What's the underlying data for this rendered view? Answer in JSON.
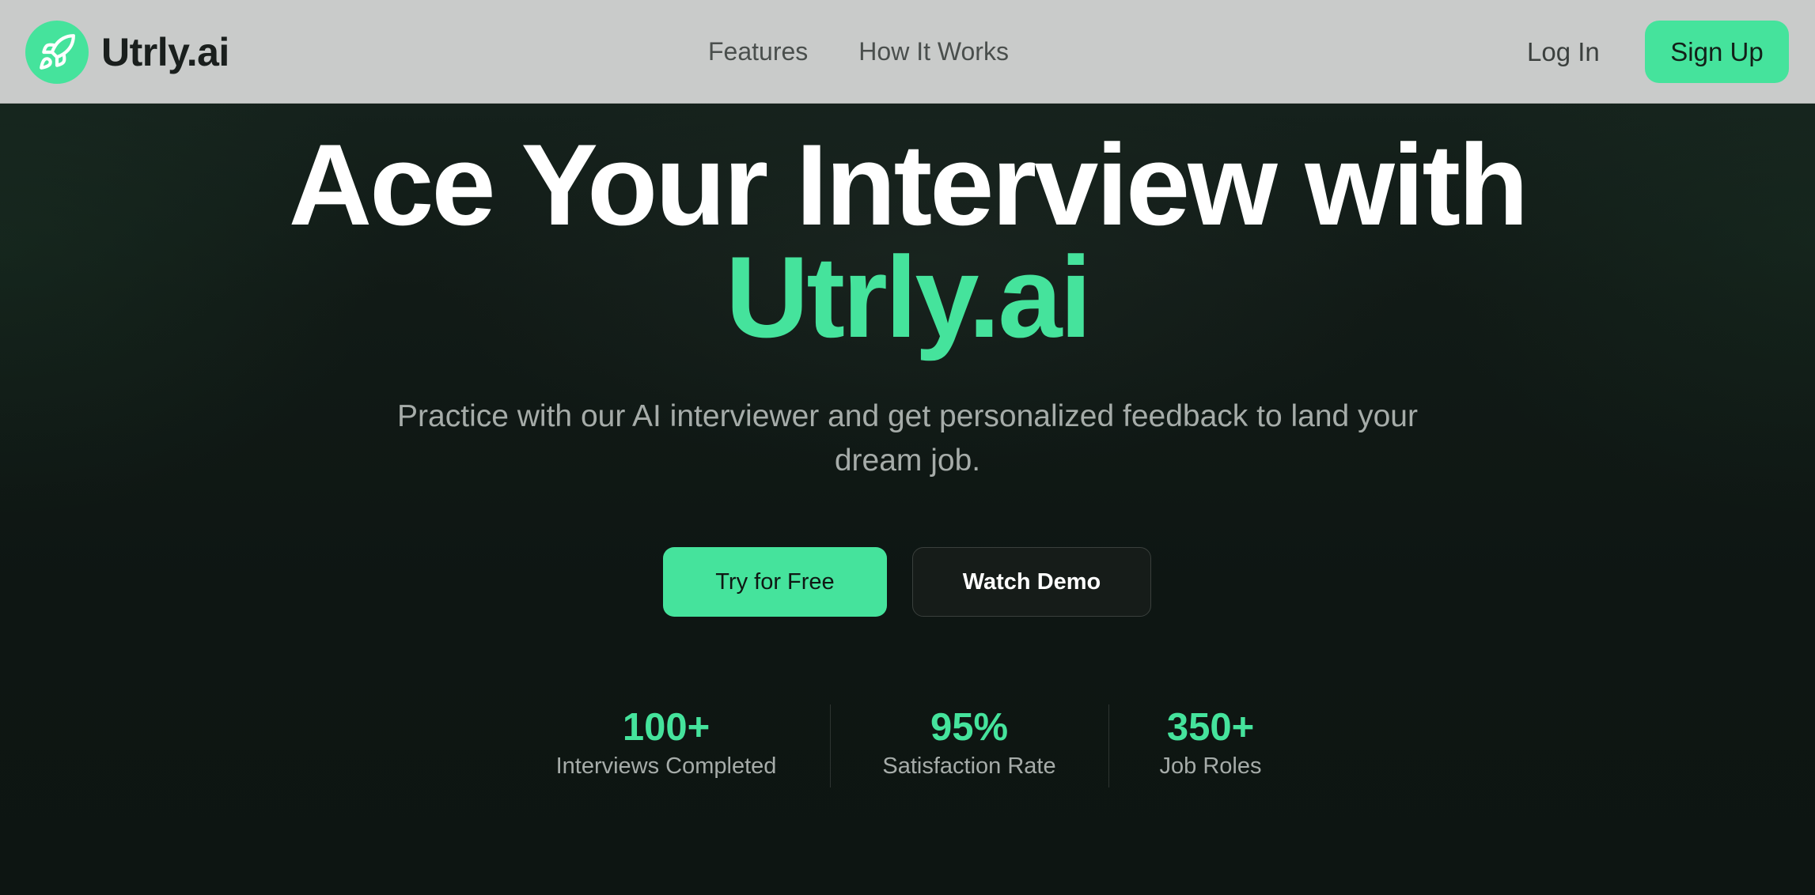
{
  "navbar": {
    "logo_text": "Utrly.ai",
    "logo_icon": "rocket-icon",
    "links": [
      {
        "label": "Features"
      },
      {
        "label": "How It Works"
      }
    ],
    "login_label": "Log In",
    "signup_label": "Sign Up"
  },
  "hero": {
    "headline_line1": "Ace Your Interview with",
    "headline_line2": "Utrly.ai",
    "subtitle": "Practice with our AI interviewer and get personalized feedback to land your dream job.",
    "primary_cta": "Try for Free",
    "secondary_cta": "Watch Demo"
  },
  "stats": [
    {
      "value": "100+",
      "label": "Interviews Completed"
    },
    {
      "value": "95%",
      "label": "Satisfaction Rate"
    },
    {
      "value": "350+",
      "label": "Job Roles"
    }
  ],
  "colors": {
    "accent": "#45e39c",
    "background": "#0f1713",
    "navbar": "#c9cbca",
    "text_muted": "#a6aca9"
  }
}
